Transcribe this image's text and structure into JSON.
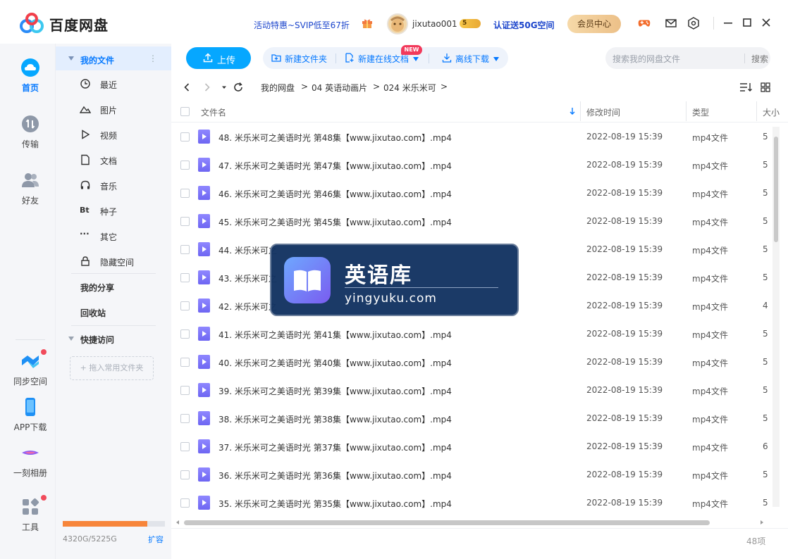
{
  "app": {
    "name": "百度网盘",
    "promo": "活动特惠~SVIP低至67折",
    "username": "jixutao001",
    "level_badge": "5",
    "verify_text": "认证送50G空间",
    "vip_button": "会员中心"
  },
  "rail": {
    "items": [
      {
        "label": "首页"
      },
      {
        "label": "传输"
      },
      {
        "label": "好友"
      },
      {
        "label": "同步空间"
      },
      {
        "label": "APP下载"
      },
      {
        "label": "一刻相册"
      },
      {
        "label": "工具"
      }
    ]
  },
  "sidebar": {
    "my_files": "我的文件",
    "items": [
      {
        "label": "最近"
      },
      {
        "label": "图片"
      },
      {
        "label": "视频"
      },
      {
        "label": "文档"
      },
      {
        "label": "音乐"
      },
      {
        "label": "种子"
      },
      {
        "label": "其它"
      },
      {
        "label": "隐藏空间"
      }
    ],
    "my_share": "我的分享",
    "recycle": "回收站",
    "quick_access": "快捷访问",
    "drag_hint": "+ 拖入常用文件夹",
    "storage_text": "4320G/5225G",
    "storage_used_fraction": 0.827,
    "expand": "扩容"
  },
  "toolbar": {
    "upload": "上传",
    "new_folder": "新建文件夹",
    "new_online_doc": "新建在线文档",
    "new_badge": "NEW",
    "offline_download": "离线下载",
    "search_placeholder": "搜索我的网盘文件",
    "search_button": "搜索"
  },
  "breadcrumb": [
    "我的网盘",
    "04 英语动画片",
    "024 米乐米可"
  ],
  "table": {
    "headers": {
      "name": "文件名",
      "modified": "修改时间",
      "type": "类型",
      "size": "大小"
    },
    "rows": [
      {
        "name": "48. 米乐米可之美语时光 第48集【www.jixutao.com】.mp4",
        "date": "2022-08-19 15:39",
        "type": "mp4文件",
        "size": "5"
      },
      {
        "name": "47. 米乐米可之美语时光 第47集【www.jixutao.com】.mp4",
        "date": "2022-08-19 15:39",
        "type": "mp4文件",
        "size": "5"
      },
      {
        "name": "46. 米乐米可之美语时光 第46集【www.jixutao.com】.mp4",
        "date": "2022-08-19 15:39",
        "type": "mp4文件",
        "size": "5"
      },
      {
        "name": "45. 米乐米可之美语时光 第45集【www.jixutao.com】.mp4",
        "date": "2022-08-19 15:39",
        "type": "mp4文件",
        "size": "5"
      },
      {
        "name": "44. 米乐米可之",
        "date": "2022-08-19 15:39",
        "type": "mp4文件",
        "size": "5"
      },
      {
        "name": "43. 米乐米可之",
        "date": "2022-08-19 15:39",
        "type": "mp4文件",
        "size": "5"
      },
      {
        "name": "42. 米乐米可之",
        "date": "2022-08-19 15:39",
        "type": "mp4文件",
        "size": "4"
      },
      {
        "name": "41. 米乐米可之美语时光 第41集【www.jixutao.com】.mp4",
        "date": "2022-08-19 15:39",
        "type": "mp4文件",
        "size": "5"
      },
      {
        "name": "40. 米乐米可之美语时光 第40集【www.jixutao.com】.mp4",
        "date": "2022-08-19 15:39",
        "type": "mp4文件",
        "size": "5"
      },
      {
        "name": "39. 米乐米可之美语时光 第39集【www.jixutao.com】.mp4",
        "date": "2022-08-19 15:39",
        "type": "mp4文件",
        "size": "5"
      },
      {
        "name": "38. 米乐米可之美语时光 第38集【www.jixutao.com】.mp4",
        "date": "2022-08-19 15:39",
        "type": "mp4文件",
        "size": "5"
      },
      {
        "name": "37. 米乐米可之美语时光 第37集【www.jixutao.com】.mp4",
        "date": "2022-08-19 15:39",
        "type": "mp4文件",
        "size": "6"
      },
      {
        "name": "36. 米乐米可之美语时光 第36集【www.jixutao.com】.mp4",
        "date": "2022-08-19 15:39",
        "type": "mp4文件",
        "size": "5"
      },
      {
        "name": "35. 米乐米可之美语时光 第35集【www.jixutao.com】.mp4",
        "date": "2022-08-19 15:39",
        "type": "mp4文件",
        "size": "5"
      }
    ],
    "count": "48项"
  },
  "watermark": {
    "title": "英语库",
    "url": "yingyuku.com"
  },
  "colors": {
    "accent": "#0679ff",
    "upload": "#06a7ff",
    "storage": "#f7853a"
  }
}
